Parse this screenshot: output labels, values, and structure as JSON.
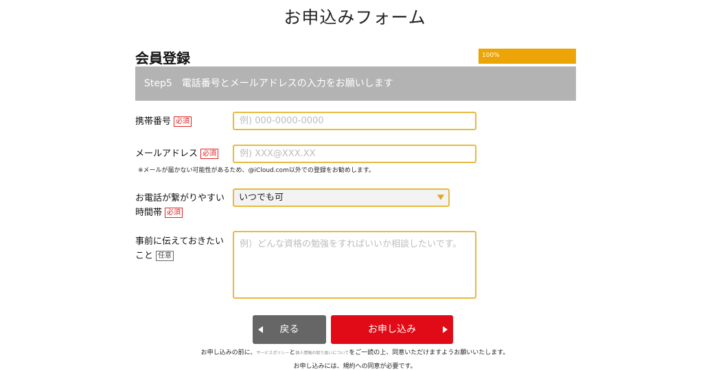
{
  "header": {
    "title": "お申込みフォーム"
  },
  "section": {
    "title": "会員登録"
  },
  "progress": {
    "label": "100%",
    "percent": 100,
    "color": "#eca406"
  },
  "step": {
    "text": "Step5　電話番号とメールアドレスの入力をお願いします"
  },
  "fields": {
    "phone": {
      "label": "携帯番号",
      "tag": "必須",
      "placeholder": "例) 000-0000-0000"
    },
    "email": {
      "label": "メールアドレス",
      "tag": "必須",
      "placeholder": "例) XXX@XXX.XX",
      "note": "※メールが届かない可能性があるため、@iCloud.com以外での登録をお勧めします。"
    },
    "time": {
      "label_line1": "お電話が繋がりやすい",
      "label_line2": "時間帯",
      "tag": "必須",
      "selected": "いつでも可"
    },
    "message": {
      "label_line1": "事前に伝えておきたい",
      "label_line2": "こと",
      "tag": "任意",
      "placeholder": "例）どんな資格の勉強をすればいいか相談したいです。"
    }
  },
  "buttons": {
    "back": "戻る",
    "submit": "お申し込み"
  },
  "footer": {
    "agree_prefix": "お申し込みの前に、",
    "service_policy": "サービスポリシー",
    "and": "と",
    "privacy": "個人情報の取り扱いについて",
    "agree_suffix": "をご一読の上、同意いただけますようお願いいたします。",
    "consent_note": "お申し込みには、規約への同意が必要です。"
  },
  "colors": {
    "accent": "#e8b83b",
    "submit": "#e00b17",
    "back": "#666666",
    "step_bar": "#b3b3b3",
    "required": "#dd2222"
  }
}
